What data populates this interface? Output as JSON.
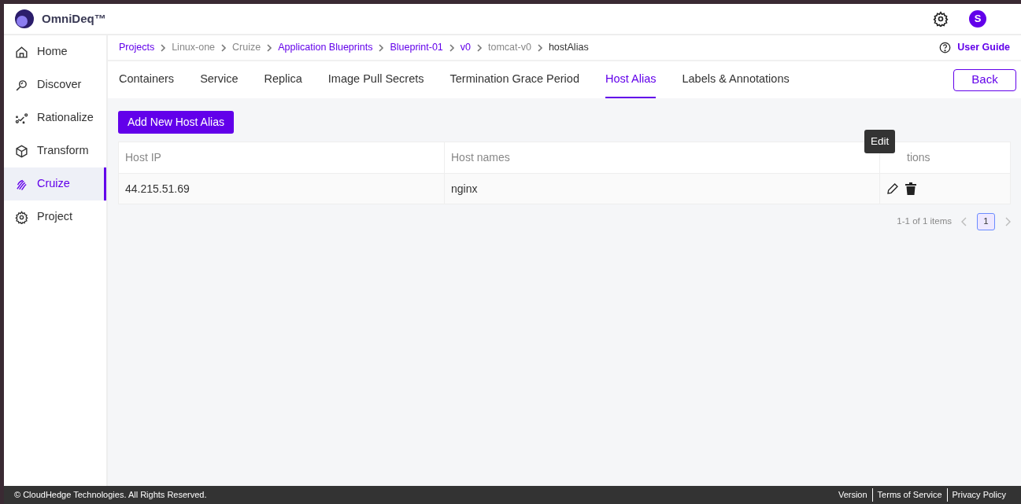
{
  "brand": {
    "name": "OmniDeq™"
  },
  "header": {
    "avatar": "S"
  },
  "sidebar": {
    "items": [
      {
        "label": "Home",
        "selected": false
      },
      {
        "label": "Discover",
        "selected": false
      },
      {
        "label": "Rationalize",
        "selected": false
      },
      {
        "label": "Transform",
        "selected": false
      },
      {
        "label": "Cruize",
        "selected": true
      },
      {
        "label": "Project",
        "selected": false
      }
    ]
  },
  "breadcrumb": [
    {
      "label": "Projects",
      "link": true,
      "current": false
    },
    {
      "label": "Linux-one",
      "link": false,
      "current": false
    },
    {
      "label": "Cruize",
      "link": false,
      "current": false
    },
    {
      "label": "Application Blueprints",
      "link": true,
      "current": false
    },
    {
      "label": "Blueprint-01",
      "link": true,
      "current": false
    },
    {
      "label": "v0",
      "link": true,
      "current": false
    },
    {
      "label": "tomcat-v0",
      "link": false,
      "current": false
    },
    {
      "label": "hostAlias",
      "link": false,
      "current": true
    }
  ],
  "user_guide": "User Guide",
  "tabs": [
    {
      "label": "Containers",
      "selected": false
    },
    {
      "label": "Service",
      "selected": false
    },
    {
      "label": "Replica",
      "selected": false
    },
    {
      "label": "Image Pull Secrets",
      "selected": false
    },
    {
      "label": "Termination Grace Period",
      "selected": false
    },
    {
      "label": "Host Alias",
      "selected": true
    },
    {
      "label": "Labels & Annotations",
      "selected": false
    }
  ],
  "back_button": "Back",
  "add_button": "Add New Host Alias",
  "table": {
    "columns": [
      "Host IP",
      "Host names",
      "tions"
    ],
    "rows": [
      {
        "cells": [
          "44.215.51.69",
          "nginx"
        ]
      }
    ]
  },
  "tooltip": "Edit",
  "pagination": {
    "summary": "1-1 of 1 items",
    "pages": [
      {
        "label": "1",
        "selected": true
      }
    ]
  },
  "footer": {
    "copyright": "© CloudHedge Technologies. All Rights Reserved.",
    "links": [
      "Version",
      "Terms of Service",
      "Privacy Policy"
    ]
  }
}
